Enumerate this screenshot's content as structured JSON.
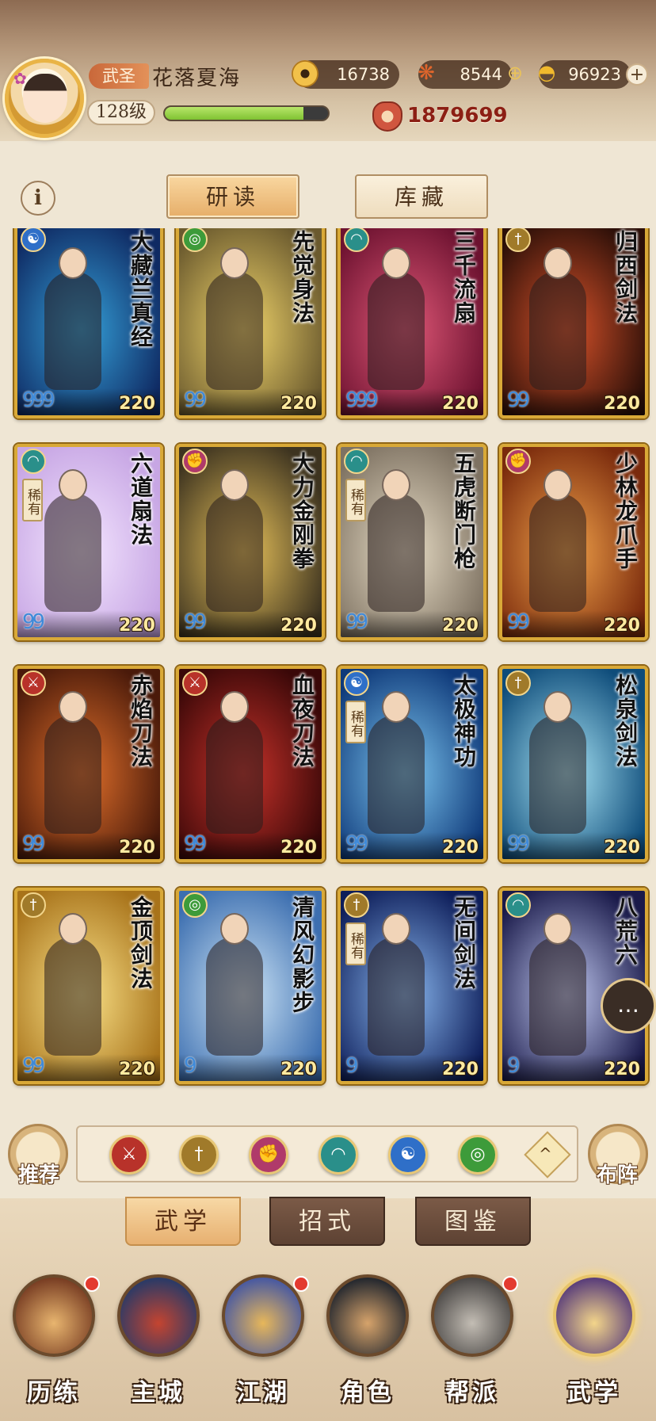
{
  "player": {
    "rank": "武圣",
    "name": "花落夏海",
    "level": "128级",
    "exp_fraction": 0.85,
    "power": "1879699"
  },
  "currencies": [
    {
      "name": "coin-icon",
      "value": "16738"
    },
    {
      "name": "leaf-icon",
      "value": "8544"
    },
    {
      "name": "gold-ingot-icon",
      "value": "96923"
    }
  ],
  "plus": "+",
  "info": "i",
  "subtabs": {
    "study": "研读",
    "storage": "库藏"
  },
  "rare_label": "稀有",
  "cards": [
    {
      "title": "大藏兰真经",
      "element": "taiji",
      "color": "#2f6fc8",
      "bg": [
        "#0f2a63",
        "#35a1d9"
      ],
      "dots": "999",
      "level": "220",
      "rare": false
    },
    {
      "title": "先觉身法",
      "element": "wind",
      "color": "#3d9b3a",
      "bg": [
        "#6b5a2e",
        "#f2d66b"
      ],
      "dots": "99",
      "level": "220",
      "rare": false
    },
    {
      "title": "三千流扇",
      "element": "fan",
      "color": "#2a8f8a",
      "bg": [
        "#6d1230",
        "#e05877"
      ],
      "dots": "999",
      "level": "220",
      "rare": false
    },
    {
      "title": "归西剑法",
      "element": "sword",
      "color": "#a07a2a",
      "bg": [
        "#2c0f08",
        "#d7522a"
      ],
      "dots": "99",
      "level": "220",
      "rare": false
    },
    {
      "title": "六道扇法",
      "element": "fan",
      "color": "#2a8f8a",
      "bg": [
        "#c7a6e4",
        "#f4e6ff"
      ],
      "dots": "99",
      "level": "220",
      "rare": true
    },
    {
      "title": "大力金刚拳",
      "element": "fist",
      "color": "#b03a6a",
      "bg": [
        "#3e3420",
        "#e8c25a"
      ],
      "dots": "99",
      "level": "220",
      "rare": false
    },
    {
      "title": "五虎断门枪",
      "element": "fan",
      "color": "#2a8f8a",
      "bg": [
        "#7e7262",
        "#e8ddc6"
      ],
      "dots": "99",
      "level": "220",
      "rare": true
    },
    {
      "title": "少林龙爪手",
      "element": "fist",
      "color": "#b03a6a",
      "bg": [
        "#7a2a0c",
        "#f1a24a"
      ],
      "dots": "99",
      "level": "220",
      "rare": false
    },
    {
      "title": "赤焰刀法",
      "element": "blade",
      "color": "#b8322a",
      "bg": [
        "#4a1a0a",
        "#e2702b"
      ],
      "dots": "99",
      "level": "220",
      "rare": false
    },
    {
      "title": "血夜刀法",
      "element": "blade",
      "color": "#b8322a",
      "bg": [
        "#3a0808",
        "#c8322a"
      ],
      "dots": "99",
      "level": "220",
      "rare": false
    },
    {
      "title": "太极神功",
      "element": "taiji",
      "color": "#2f6fc8",
      "bg": [
        "#0f3a7a",
        "#7cc5ef"
      ],
      "dots": "99",
      "level": "220",
      "rare": true
    },
    {
      "title": "松泉剑法",
      "element": "sword",
      "color": "#a07a2a",
      "bg": [
        "#0e4c7a",
        "#a6e2f3"
      ],
      "dots": "99",
      "level": "220",
      "rare": false
    },
    {
      "title": "金顶剑法",
      "element": "sword",
      "color": "#a07a2a",
      "bg": [
        "#a8731a",
        "#fbe38a"
      ],
      "dots": "99",
      "level": "220",
      "rare": false
    },
    {
      "title": "清风幻影步",
      "element": "wind",
      "color": "#3d9b3a",
      "bg": [
        "#3d6fb0",
        "#cfe6f7"
      ],
      "dots": "9",
      "level": "220",
      "rare": false
    },
    {
      "title": "无间剑法",
      "element": "sword",
      "color": "#a07a2a",
      "bg": [
        "#0e1e5a",
        "#8ab8ef"
      ],
      "dots": "9",
      "level": "220",
      "rare": true
    },
    {
      "title": "八荒六",
      "element": "fan",
      "color": "#2a8f8a",
      "bg": [
        "#1a1a4a",
        "#c0c8f0"
      ],
      "dots": "9",
      "level": "220",
      "rare": false
    }
  ],
  "filters": [
    {
      "name": "blade-filter-icon",
      "glyph": "⚔",
      "color": "#b8322a"
    },
    {
      "name": "sword-filter-icon",
      "glyph": "†",
      "color": "#a07a2a"
    },
    {
      "name": "fist-filter-icon",
      "glyph": "✊",
      "color": "#b03a6a"
    },
    {
      "name": "fan-filter-icon",
      "glyph": "◠",
      "color": "#2a8f8a"
    },
    {
      "name": "taiji-filter-icon",
      "glyph": "☯",
      "color": "#2f6fc8"
    },
    {
      "name": "wind-filter-icon",
      "glyph": "◎",
      "color": "#3d9b3a"
    }
  ],
  "filter_collapse": "^",
  "side_buttons": {
    "recommend": "推荐",
    "formation": "布阵"
  },
  "section_tabs": [
    "武学",
    "招式",
    "图鉴"
  ],
  "nav": [
    {
      "label": "历练",
      "colors": [
        "#7a3f24",
        "#e8b56f"
      ],
      "dot": true
    },
    {
      "label": "主城",
      "colors": [
        "#2b3a66",
        "#c44430"
      ],
      "dot": false
    },
    {
      "label": "江湖",
      "colors": [
        "#4a5aa0",
        "#e7b75a"
      ],
      "dot": true
    },
    {
      "label": "角色",
      "colors": [
        "#26292f",
        "#d6a36b"
      ],
      "dot": false
    },
    {
      "label": "帮派",
      "colors": [
        "#4d4a48",
        "#c3bdb4"
      ],
      "dot": true
    },
    {
      "label": "武学",
      "colors": [
        "#5b3f7a",
        "#f3d58a"
      ],
      "dot": false
    }
  ],
  "chat_glyph": "…"
}
